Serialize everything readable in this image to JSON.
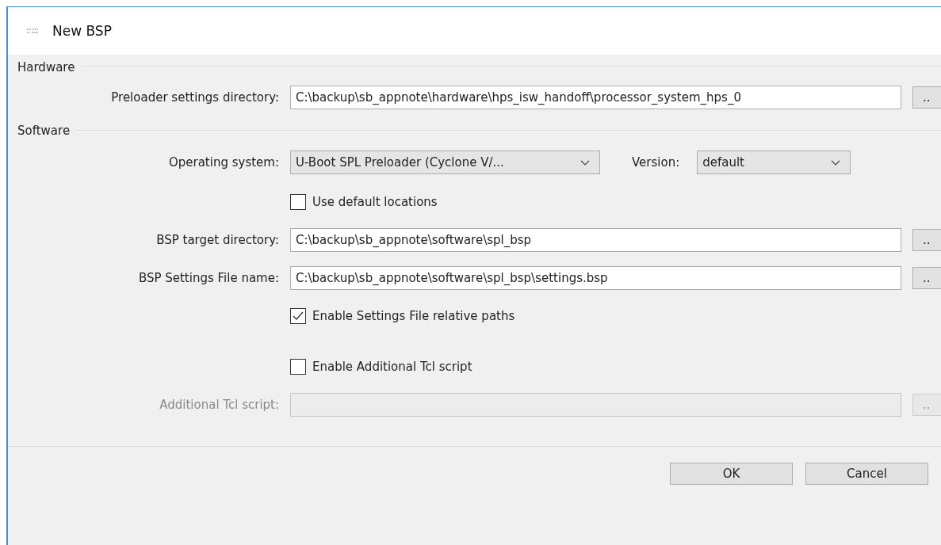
{
  "window": {
    "title": "New BSP"
  },
  "hardware": {
    "title": "Hardware",
    "rows": [
      {
        "label": "Preloader settings directory:",
        "value": "C:\\backup\\sb_appnote\\hardware\\hps_isw_handoff\\processor_system_hps_0",
        "browse": ".."
      }
    ]
  },
  "software": {
    "title": "Software",
    "os": {
      "label": "Operating system:",
      "value": "U-Boot SPL Preloader (Cyclone V/..."
    },
    "version": {
      "label": "Version:",
      "value": "default"
    },
    "items": [
      {
        "kind": "checkbox",
        "label": "Use default locations",
        "checked": false
      },
      {
        "kind": "path",
        "label": "BSP target directory:",
        "value": "C:\\backup\\sb_appnote\\software\\spl_bsp",
        "browse": "..",
        "disabled": false
      },
      {
        "kind": "path",
        "label": "BSP Settings File name:",
        "value": "C:\\backup\\sb_appnote\\software\\spl_bsp\\settings.bsp",
        "browse": "..",
        "disabled": false
      },
      {
        "kind": "checkbox",
        "label": "Enable Settings File relative paths",
        "checked": true
      },
      {
        "kind": "checkbox",
        "label": "Enable Additional Tcl script",
        "checked": false
      },
      {
        "kind": "path",
        "label": "Additional Tcl script:",
        "browse": "..",
        "disabled": true
      }
    ]
  },
  "buttons": [
    "OK",
    "Cancel"
  ]
}
